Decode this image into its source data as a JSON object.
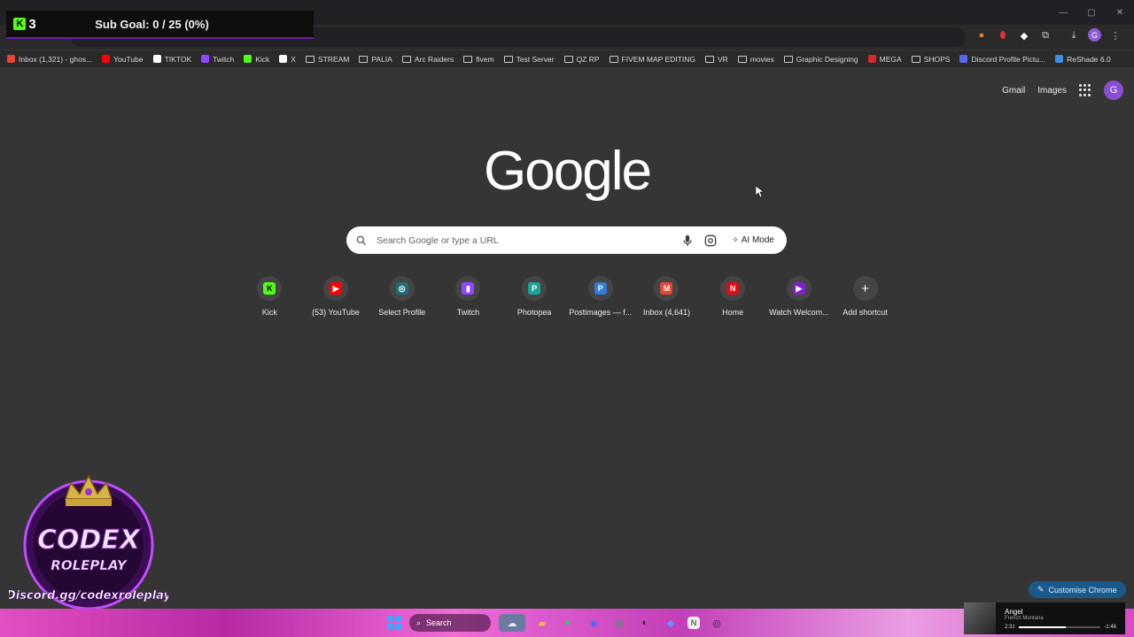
{
  "overlay": {
    "kick_count": "3",
    "subgoal_text": "Sub Goal:  0 / 25 (0%)"
  },
  "bookmarks": [
    {
      "label": "Inbox (1,321) - ghos...",
      "icon": "gmail-icon",
      "color": "#ea4335"
    },
    {
      "label": "YouTube",
      "icon": "youtube-icon",
      "color": "#ff0000"
    },
    {
      "label": "TIKTOK",
      "icon": "tiktok-icon",
      "color": "#ffffff"
    },
    {
      "label": "Twitch",
      "icon": "twitch-icon",
      "color": "#9146ff"
    },
    {
      "label": "Kick",
      "icon": "kick-icon",
      "color": "#53fc18"
    },
    {
      "label": "X",
      "icon": "x-icon",
      "color": "#ffffff"
    },
    {
      "label": "STREAM",
      "icon": "folder-icon"
    },
    {
      "label": "PALIA",
      "icon": "folder-icon"
    },
    {
      "label": "Arc Raiders",
      "icon": "folder-icon"
    },
    {
      "label": "fivem",
      "icon": "folder-icon"
    },
    {
      "label": "Test Server",
      "icon": "folder-icon"
    },
    {
      "label": "QZ RP",
      "icon": "folder-icon"
    },
    {
      "label": "FIVEM MAP EDITING",
      "icon": "folder-icon"
    },
    {
      "label": "VR",
      "icon": "folder-icon"
    },
    {
      "label": "movies",
      "icon": "folder-icon"
    },
    {
      "label": "Graphic Designing",
      "icon": "folder-icon"
    },
    {
      "label": "MEGA",
      "icon": "mega-icon",
      "color": "#d9272e"
    },
    {
      "label": "SHOPS",
      "icon": "folder-icon"
    },
    {
      "label": "Discord Profile Pictu...",
      "icon": "discord-icon",
      "color": "#5865f2"
    },
    {
      "label": "ReShade 6.0",
      "icon": "reshade-icon",
      "color": "#3a8ee6"
    }
  ],
  "google": {
    "gmail": "Gmail",
    "images": "Images",
    "avatar_letter": "G",
    "logo": "Google",
    "search_placeholder": "Search Google or type a URL",
    "ai_mode": "AI Mode"
  },
  "shortcuts": [
    {
      "label": "Kick",
      "icon": "kick-icon",
      "color": "#53fc18",
      "glyph": "K"
    },
    {
      "label": "(53) YouTube",
      "icon": "youtube-icon",
      "color": "#ff0000",
      "glyph": "▶"
    },
    {
      "label": "Select Profile",
      "icon": "profile-icon",
      "color": "#1f6f74",
      "glyph": "◎"
    },
    {
      "label": "Twitch",
      "icon": "twitch-icon",
      "color": "#9146ff",
      "glyph": "▮"
    },
    {
      "label": "Photopea",
      "icon": "photopea-icon",
      "color": "#18a497",
      "glyph": "P"
    },
    {
      "label": "Postimages — f...",
      "icon": "postimages-icon",
      "color": "#2e7dd7",
      "glyph": "P"
    },
    {
      "label": "Inbox (4,641)",
      "icon": "gmail-icon",
      "color": "#ea4335",
      "glyph": "M"
    },
    {
      "label": "Home",
      "icon": "netflix-icon",
      "color": "#e50914",
      "glyph": "N"
    },
    {
      "label": "Watch Welcom...",
      "icon": "play-icon",
      "color": "#7b22c9",
      "glyph": "▶"
    },
    {
      "label": "Add shortcut",
      "icon": "plus-icon",
      "color": "#454545",
      "glyph": "+"
    }
  ],
  "customise": "Customise Chrome",
  "taskbar": {
    "search": "Search"
  },
  "music": {
    "title": "Angel",
    "artist": "French Montana",
    "elapsed": "2:31",
    "remaining": "-1:46",
    "progress": 0.58
  },
  "codex": {
    "line1": "CODEX",
    "line2": "ROLEPLAY",
    "line3": "Discord.gg/codexroleplay"
  }
}
